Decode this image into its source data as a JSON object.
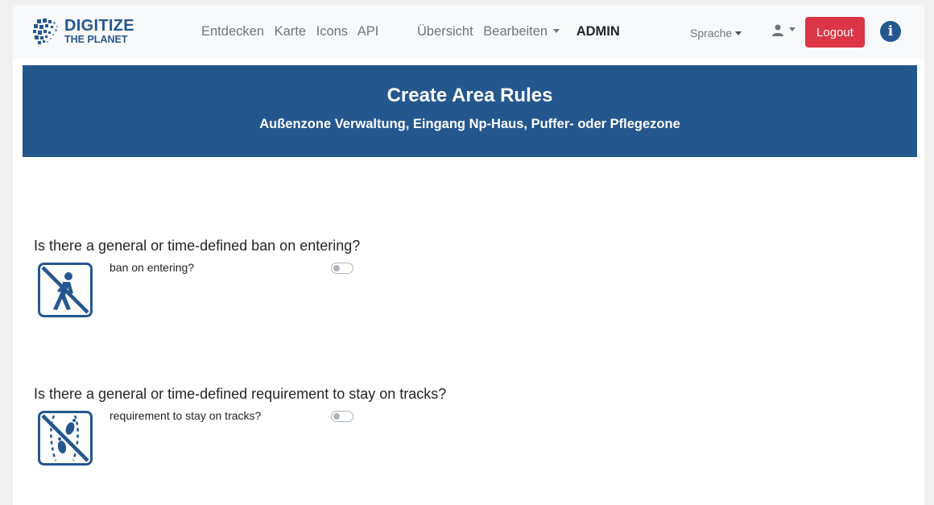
{
  "brand": {
    "line1": "DIGITIZE",
    "line2": "THE PLANET",
    "color": "#25578f",
    "logo_icon": "pixel-globe-logo"
  },
  "nav": {
    "left_items": [
      "Entdecken",
      "Karte",
      "Icons",
      "API"
    ],
    "overview": "Übersicht",
    "edit": "Bearbeiten",
    "admin": "ADMIN",
    "language": "Sprache",
    "user_icon": "user-icon",
    "logout": "Logout",
    "info_icon": "info-icon",
    "logout_color": "#dc3545"
  },
  "hero": {
    "title": "Create Area Rules",
    "subtitle": "Außenzone Verwaltung, Eingang Np-Haus, Puffer- oder Pflegezone",
    "background": "#25578f"
  },
  "rules": [
    {
      "question": "Is there a general or time-defined ban on entering?",
      "label": "ban on entering?",
      "icon": "no-entry-walker-icon",
      "enabled": false
    },
    {
      "question": "Is there a general or time-defined requirement to stay on tracks?",
      "label": "requirement to stay on tracks?",
      "icon": "stay-on-track-footprints-icon",
      "enabled": false
    }
  ]
}
